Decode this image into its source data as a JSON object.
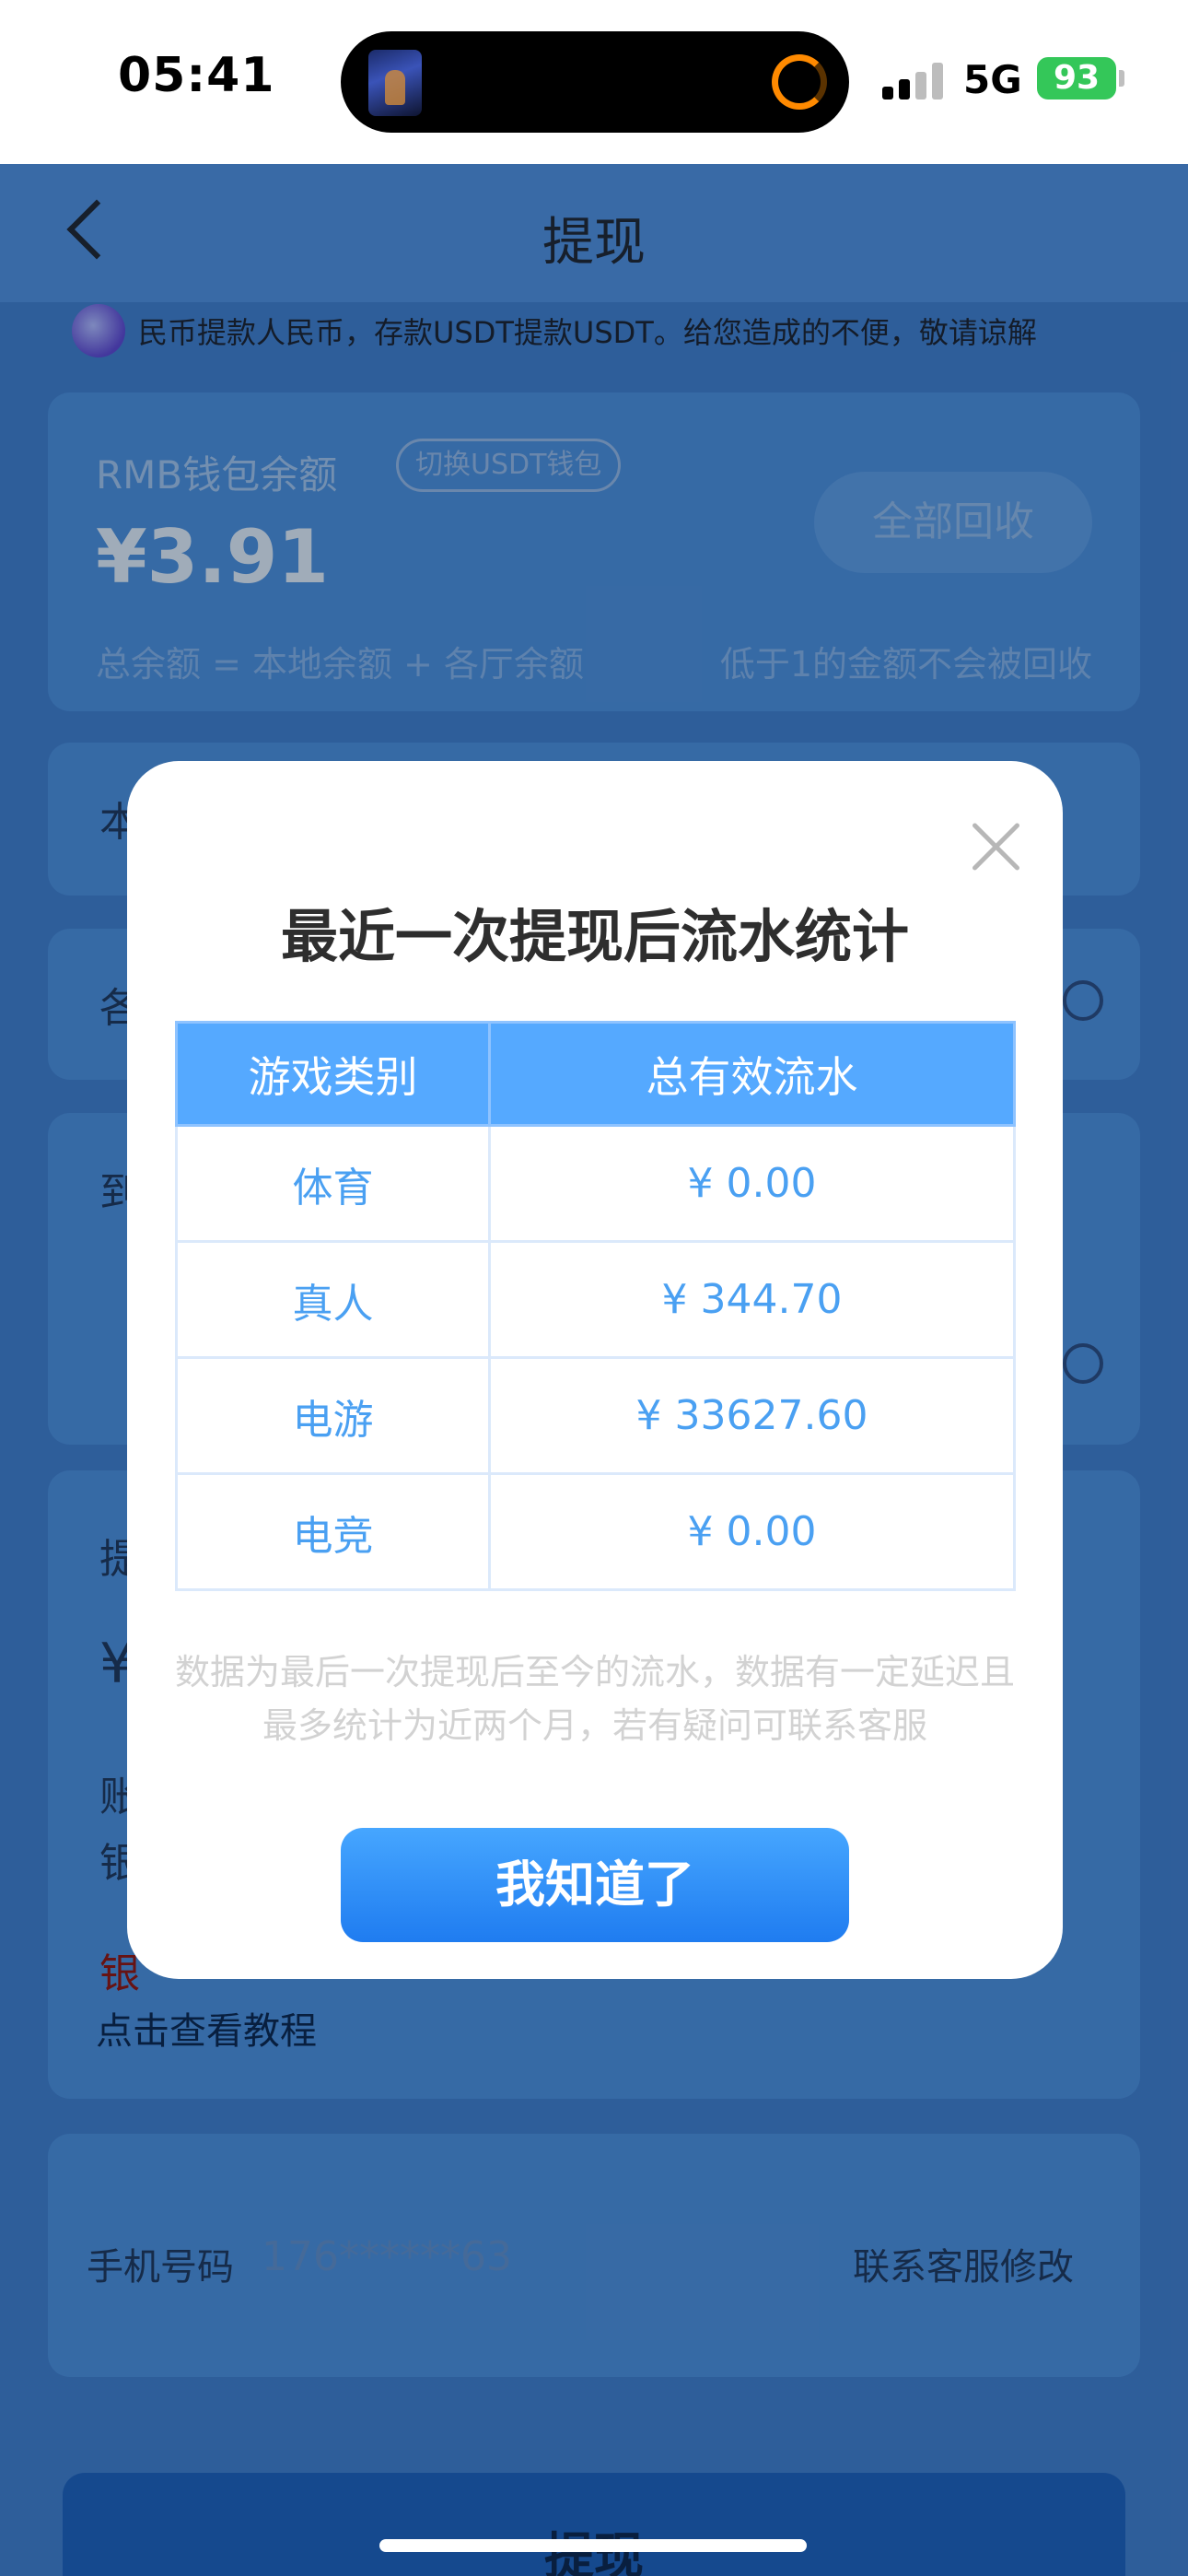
{
  "status_bar": {
    "time": "05:41",
    "network": "5G",
    "battery": "93"
  },
  "header": {
    "title": "提现"
  },
  "notice": {
    "text": "民币提款人民币，存款USDT提款USDT。给您造成的不便，敬请谅解"
  },
  "wallet": {
    "label": "RMB钱包余额",
    "switch_label": "切换USDT钱包",
    "amount": "¥3.91",
    "recycle_button": "全部回收",
    "formula": "总余额 = 本地余额 + 各厅余额",
    "note": "低于1的金额不会被回收"
  },
  "cards_partial": {
    "card2_stub": "本",
    "card3_stub": "各",
    "card4_stub": "到",
    "card5_stub1": "提",
    "card5_stub2": "¥",
    "card5_stub3": "账",
    "card5_stub4": "银",
    "card5_stub5": "银",
    "tutorial_link": "点击查看教程"
  },
  "phone": {
    "label": "手机号码",
    "value": "176******63",
    "modify_link": "联系客服修改"
  },
  "submit_button": "提现",
  "modal": {
    "title": "最近一次提现后流水统计",
    "columns": [
      "游戏类别",
      "总有效流水"
    ],
    "rows": [
      {
        "category": "体育",
        "amount": "¥ 0.00"
      },
      {
        "category": "真人",
        "amount": "¥ 344.70"
      },
      {
        "category": "电游",
        "amount": "¥ 33627.60"
      },
      {
        "category": "电竞",
        "amount": "¥ 0.00"
      }
    ],
    "note": "数据为最后一次提现后至今的流水，数据有一定延迟且最多统计为近两个月，若有疑问可联系客服",
    "ok_button": "我知道了"
  },
  "colors": {
    "accent": "#1f7cf0",
    "table_header": "#55a9ff",
    "table_text": "#4aa0f2"
  }
}
